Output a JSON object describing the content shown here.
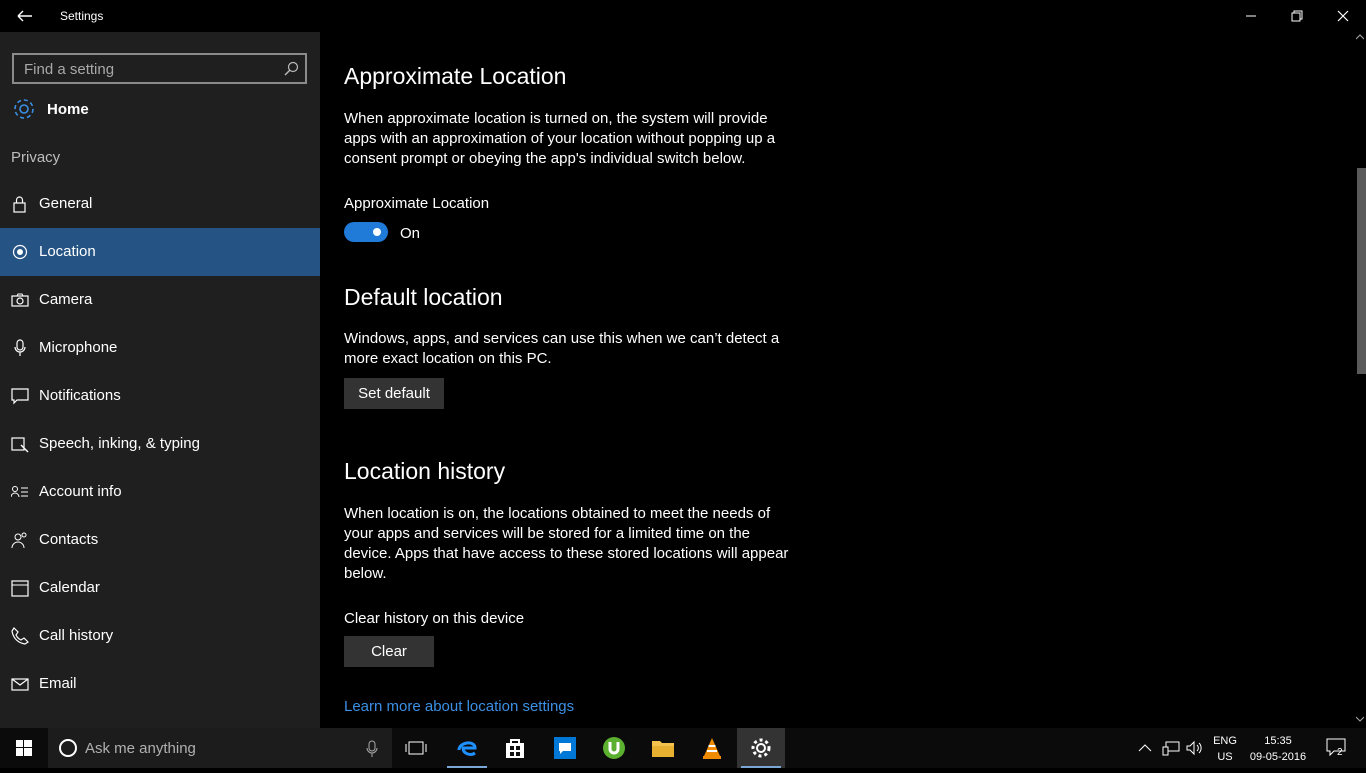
{
  "window": {
    "title": "Settings"
  },
  "sidebar": {
    "search_placeholder": "Find a setting",
    "home_label": "Home",
    "section_label": "Privacy",
    "items": [
      {
        "label": "General",
        "icon": "lock-icon"
      },
      {
        "label": "Location",
        "icon": "location-icon",
        "active": true
      },
      {
        "label": "Camera",
        "icon": "camera-icon"
      },
      {
        "label": "Microphone",
        "icon": "microphone-icon"
      },
      {
        "label": "Notifications",
        "icon": "notifications-icon"
      },
      {
        "label": "Speech, inking, & typing",
        "icon": "speech-icon"
      },
      {
        "label": "Account info",
        "icon": "account-info-icon"
      },
      {
        "label": "Contacts",
        "icon": "contacts-icon"
      },
      {
        "label": "Calendar",
        "icon": "calendar-icon"
      },
      {
        "label": "Call history",
        "icon": "call-history-icon"
      },
      {
        "label": "Email",
        "icon": "email-icon"
      }
    ]
  },
  "content": {
    "approx": {
      "heading": "Approximate Location",
      "description": "When approximate location is turned on, the system will provide apps with an approximation of your location without popping up a consent prompt or obeying the app's individual switch below.",
      "toggle_label": "Approximate Location",
      "toggle_state": "On"
    },
    "default": {
      "heading": "Default location",
      "description": "Windows, apps, and services can use this when we can’t detect a more exact location on this PC.",
      "button": "Set default"
    },
    "history": {
      "heading": "Location history",
      "description": "When location is on, the locations obtained to meet the needs of your apps and services will be stored for a limited time on the device. Apps that have access to these stored locations will appear below.",
      "clear_label": "Clear history on this device",
      "button": "Clear"
    },
    "link": "Learn more about location settings"
  },
  "taskbar": {
    "search_placeholder": "Ask me anything",
    "lang_line1": "ENG",
    "lang_line2": "US",
    "time": "15:35",
    "date": "09-05-2016",
    "notification_count": "2"
  },
  "colors": {
    "accent": "#245384",
    "toggle_on": "#1f7ad8",
    "link": "#3b8fe4"
  }
}
